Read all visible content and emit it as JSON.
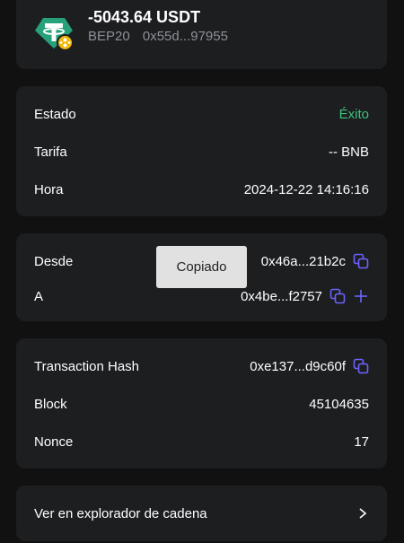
{
  "token": {
    "amount": "-5043.64 USDT",
    "network": "BEP20",
    "address": "0x55d...97955",
    "icon": "tether-icon",
    "badge_icon": "bnb-chain-icon"
  },
  "status": {
    "state_label": "Estado",
    "state_value": "Éxito",
    "fee_label": "Tarifa",
    "fee_value": "-- BNB",
    "time_label": "Hora",
    "time_value": "2024-12-22 14:16:16"
  },
  "addresses": {
    "from_label": "Desde",
    "from_value": "0x46a...21b2c",
    "to_label": "A",
    "to_value": "0x4be...f2757"
  },
  "toast": {
    "text": "Copiado"
  },
  "tx": {
    "hash_label": "Transaction Hash",
    "hash_value": "0xe137...d9c60f",
    "block_label": "Block",
    "block_value": "45104635",
    "nonce_label": "Nonce",
    "nonce_value": "17"
  },
  "explorer": {
    "label": "Ver en explorador de cadena"
  },
  "colors": {
    "background": "#111111",
    "card": "#1d1e20",
    "success": "#3cc47c",
    "accent": "#6c63ff",
    "tether": "#26a17b",
    "bnb": "#f0b90b"
  }
}
